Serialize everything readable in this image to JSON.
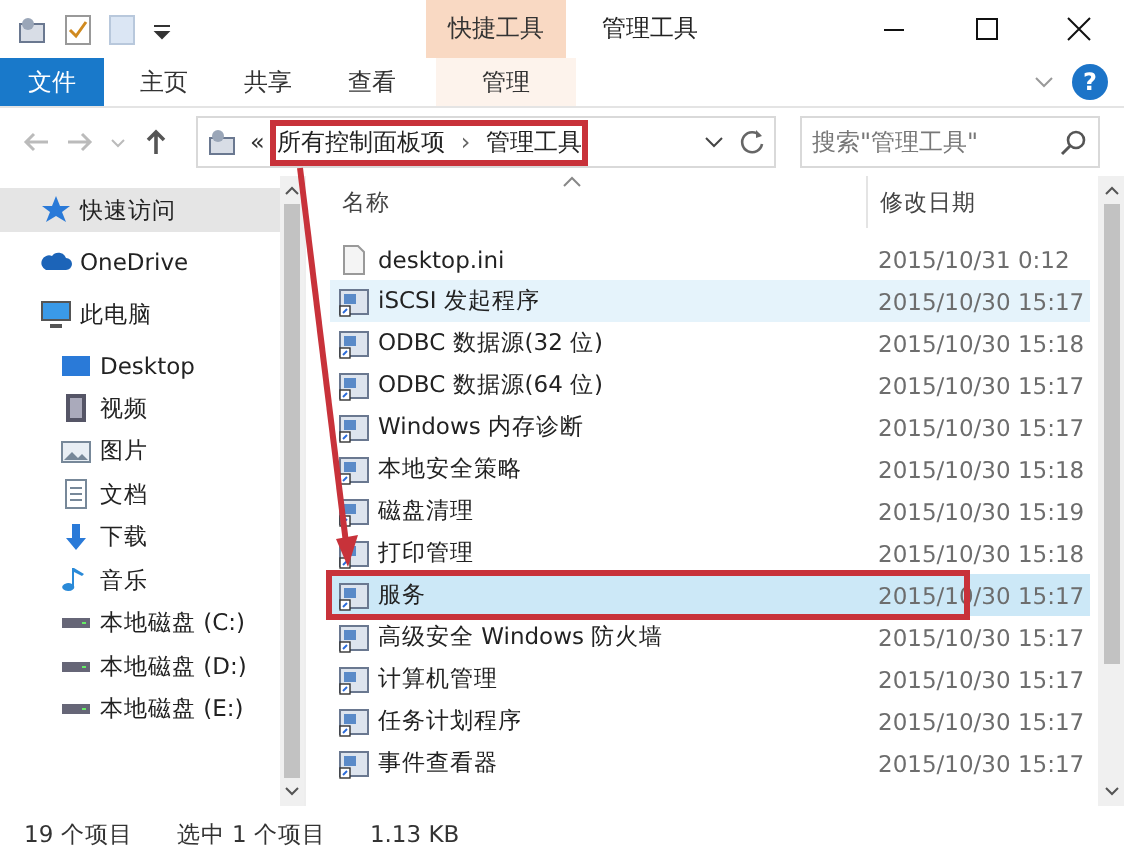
{
  "window": {
    "title": "管理工具",
    "context_tab": "快捷工具"
  },
  "ribbon_tabs": [
    {
      "label": "文件",
      "kind": "file",
      "selected": false
    },
    {
      "label": "主页",
      "kind": "tab",
      "selected": false
    },
    {
      "label": "共享",
      "kind": "tab",
      "selected": false
    },
    {
      "label": "查看",
      "kind": "tab",
      "selected": false
    },
    {
      "label": "管理",
      "kind": "context",
      "selected": false
    }
  ],
  "help": "?",
  "address": {
    "prefix": "«",
    "crumbs": [
      "所有控制面板项",
      "管理工具"
    ],
    "separator": "›"
  },
  "search": {
    "placeholder": "搜索\"管理工具\""
  },
  "sidebar": {
    "items": [
      {
        "label": "快速访问",
        "selected": true
      },
      {
        "label": "OneDrive",
        "selected": false
      },
      {
        "label": "此电脑",
        "selected": false,
        "children": [
          {
            "label": "Desktop",
            "selected": false
          },
          {
            "label": "视频",
            "selected": false
          },
          {
            "label": "图片",
            "selected": false
          },
          {
            "label": "文档",
            "selected": false
          },
          {
            "label": "下载",
            "selected": false
          },
          {
            "label": "音乐",
            "selected": false
          },
          {
            "label": "本地磁盘 (C:)",
            "selected": false
          },
          {
            "label": "本地磁盘 (D:)",
            "selected": false
          },
          {
            "label": "本地磁盘 (E:)",
            "selected": false
          }
        ]
      }
    ]
  },
  "table": {
    "columns": [
      "名称",
      "修改日期"
    ],
    "rows": [
      {
        "name": "desktop.ini",
        "date": "2015/10/31 0:12",
        "kind": "file",
        "selected": false,
        "hovered": false
      },
      {
        "name": "iSCSI 发起程序",
        "date": "2015/10/30 15:17",
        "kind": "tool",
        "selected": false,
        "hovered": true
      },
      {
        "name": "ODBC 数据源(32 位)",
        "date": "2015/10/30 15:18",
        "kind": "tool",
        "selected": false,
        "hovered": false
      },
      {
        "name": "ODBC 数据源(64 位)",
        "date": "2015/10/30 15:17",
        "kind": "tool",
        "selected": false,
        "hovered": false
      },
      {
        "name": "Windows 内存诊断",
        "date": "2015/10/30 15:17",
        "kind": "tool",
        "selected": false,
        "hovered": false
      },
      {
        "name": "本地安全策略",
        "date": "2015/10/30 15:18",
        "kind": "tool",
        "selected": false,
        "hovered": false
      },
      {
        "name": "磁盘清理",
        "date": "2015/10/30 15:19",
        "kind": "tool",
        "selected": false,
        "hovered": false
      },
      {
        "name": "打印管理",
        "date": "2015/10/30 15:18",
        "kind": "tool",
        "selected": false,
        "hovered": false
      },
      {
        "name": "服务",
        "date": "2015/10/30 15:17",
        "kind": "tool",
        "selected": true,
        "hovered": false
      },
      {
        "name": "高级安全 Windows 防火墙",
        "date": "2015/10/30 15:17",
        "kind": "tool",
        "selected": false,
        "hovered": false
      },
      {
        "name": "计算机管理",
        "date": "2015/10/30 15:17",
        "kind": "tool",
        "selected": false,
        "hovered": false
      },
      {
        "name": "任务计划程序",
        "date": "2015/10/30 15:17",
        "kind": "tool",
        "selected": false,
        "hovered": false
      },
      {
        "name": "事件查看器",
        "date": "2015/10/30 15:17",
        "kind": "tool",
        "selected": false,
        "hovered": false
      }
    ]
  },
  "annotations": {
    "color": "#c8323a",
    "box_address": true,
    "box_selected": true,
    "arrow": true
  },
  "status_bar": {
    "count": "19 个项目",
    "selection": "选中 1 个项目",
    "size": "1.13 KB"
  }
}
